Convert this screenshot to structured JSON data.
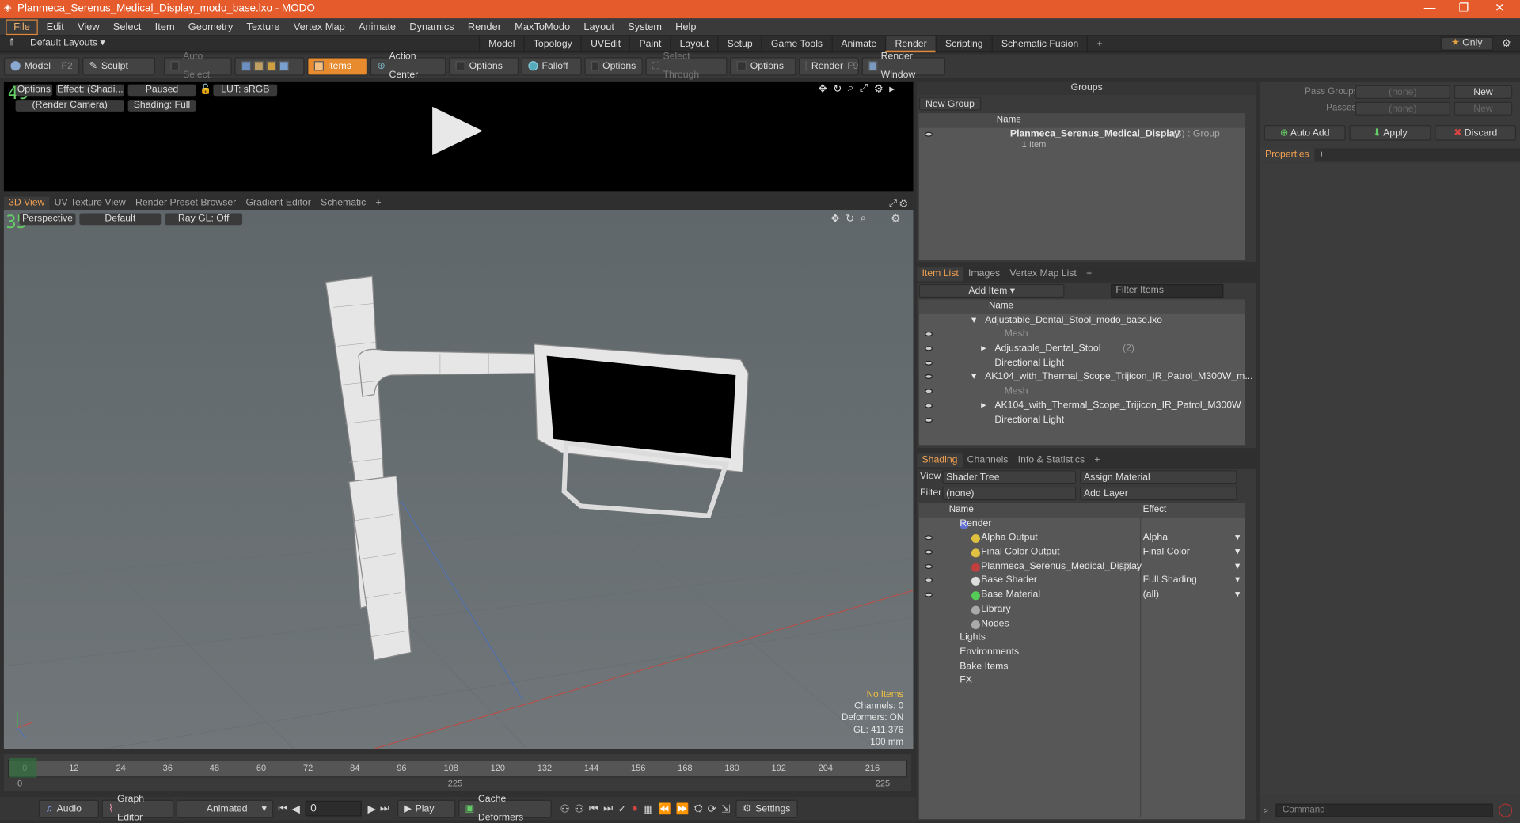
{
  "window": {
    "title": "Planmeca_Serenus_Medical_Display_modo_base.lxo - MODO"
  },
  "menu": [
    "File",
    "Edit",
    "View",
    "Select",
    "Item",
    "Geometry",
    "Texture",
    "Vertex Map",
    "Animate",
    "Dynamics",
    "Render",
    "MaxToModo",
    "Layout",
    "System",
    "Help"
  ],
  "layouts": {
    "default_label": "Default Layouts",
    "tabs": [
      "Model",
      "Topology",
      "UVEdit",
      "Paint",
      "Layout",
      "Setup",
      "Game Tools",
      "Animate",
      "Render",
      "Scripting",
      "Schematic Fusion"
    ],
    "selected": "Render",
    "only_label": "Only"
  },
  "toolbar": {
    "model": "Model",
    "model_key": "F2",
    "sculpt": "Sculpt",
    "auto_select": "Auto Select",
    "items": "Items",
    "action_center": "Action Center",
    "options1": "Options",
    "falloff": "Falloff",
    "options2": "Options",
    "select_through": "Select Through",
    "options3": "Options",
    "render": "Render",
    "render_key": "F9",
    "render_window": "Render Window"
  },
  "render_view": {
    "options": "Options",
    "effect": "Effect: (Shadi...",
    "paused": "Paused",
    "lut": "LUT: sRGB",
    "camera": "(Render Camera)",
    "shading": "Shading: Full",
    "fps_overlay": "49"
  },
  "view_tabs": [
    "3D View",
    "UV Texture View",
    "Render Preset Browser",
    "Gradient Editor",
    "Schematic"
  ],
  "viewport": {
    "perspective": "Perspective",
    "default": "Default",
    "raygl": "Ray GL: Off",
    "fps_overlay": "35",
    "stats": {
      "no_items": "No Items",
      "channels": "Channels: 0",
      "deformers": "Deformers: ON",
      "gl": "GL: 411,376",
      "unit": "100 mm"
    }
  },
  "timeline": {
    "ticks": [
      "0",
      "12",
      "24",
      "36",
      "48",
      "60",
      "72",
      "84",
      "96",
      "108",
      "120",
      "132",
      "144",
      "156",
      "168",
      "180",
      "192",
      "204",
      "216"
    ],
    "start": "0",
    "mid": "225",
    "end": "225",
    "marker": "0"
  },
  "bottom": {
    "audio": "Audio",
    "graph_editor": "Graph Editor",
    "animated": "Animated",
    "frame": "0",
    "play": "Play",
    "cache_deformers": "Cache Deformers",
    "settings": "Settings"
  },
  "groups": {
    "title": "Groups",
    "new_group": "New Group",
    "col_name": "Name",
    "item": {
      "name": "Planmeca_Serenus_Medical_Display",
      "count": "(3)",
      "type": ": Group",
      "sub": "1 Item"
    }
  },
  "item_list": {
    "tabs": [
      "Item List",
      "Images",
      "Vertex Map List"
    ],
    "add_item": "Add Item",
    "filter": "Filter Items",
    "col_name": "Name",
    "rows": [
      {
        "label": "Adjustable_Dental_Stool_modo_base.lxo",
        "indent": 0,
        "muted": false,
        "extra": ""
      },
      {
        "label": "Mesh",
        "indent": 2,
        "muted": true,
        "extra": ""
      },
      {
        "label": "Adjustable_Dental_Stool",
        "indent": 1,
        "muted": false,
        "extra": "(2)"
      },
      {
        "label": "Directional Light",
        "indent": 1,
        "muted": false,
        "extra": ""
      },
      {
        "label": "AK104_with_Thermal_Scope_Trijicon_IR_Patrol_M300W_m...",
        "indent": 0,
        "muted": false,
        "extra": ""
      },
      {
        "label": "Mesh",
        "indent": 2,
        "muted": true,
        "extra": ""
      },
      {
        "label": "AK104_with_Thermal_Scope_Trijicon_IR_Patrol_M300W",
        "indent": 1,
        "muted": false,
        "extra": "..."
      },
      {
        "label": "Directional Light",
        "indent": 1,
        "muted": false,
        "extra": ""
      }
    ]
  },
  "shading": {
    "tabs": [
      "Shading",
      "Channels",
      "Info & Statistics"
    ],
    "view_label": "View",
    "view_value": "Shader Tree",
    "assign": "Assign Material",
    "filter_label": "Filter",
    "filter_value": "(none)",
    "add_layer": "Add Layer",
    "col_name": "Name",
    "col_effect": "Effect",
    "rows": [
      {
        "label": "Render",
        "effect": "",
        "indent": 0
      },
      {
        "label": "Alpha Output",
        "effect": "Alpha",
        "indent": 1
      },
      {
        "label": "Final Color Output",
        "effect": "Final Color",
        "indent": 1
      },
      {
        "label": "Planmeca_Serenus_Medical_Display",
        "effect": "",
        "indent": 1,
        "extra": "(2)..."
      },
      {
        "label": "Base Shader",
        "effect": "Full Shading",
        "indent": 1
      },
      {
        "label": "Base Material",
        "effect": "(all)",
        "indent": 1
      },
      {
        "label": "Library",
        "effect": "",
        "indent": 1
      },
      {
        "label": "Nodes",
        "effect": "",
        "indent": 1
      },
      {
        "label": "Lights",
        "effect": "",
        "indent": 0
      },
      {
        "label": "Environments",
        "effect": "",
        "indent": 0
      },
      {
        "label": "Bake Items",
        "effect": "",
        "indent": 0
      },
      {
        "label": "FX",
        "effect": "",
        "indent": 0
      }
    ]
  },
  "passes": {
    "pass_groups": "Pass Groups",
    "passes": "Passes",
    "none": "(none)",
    "new": "New",
    "auto_add": "Auto Add",
    "apply": "Apply",
    "discard": "Discard",
    "properties": "Properties",
    "command": "Command"
  }
}
